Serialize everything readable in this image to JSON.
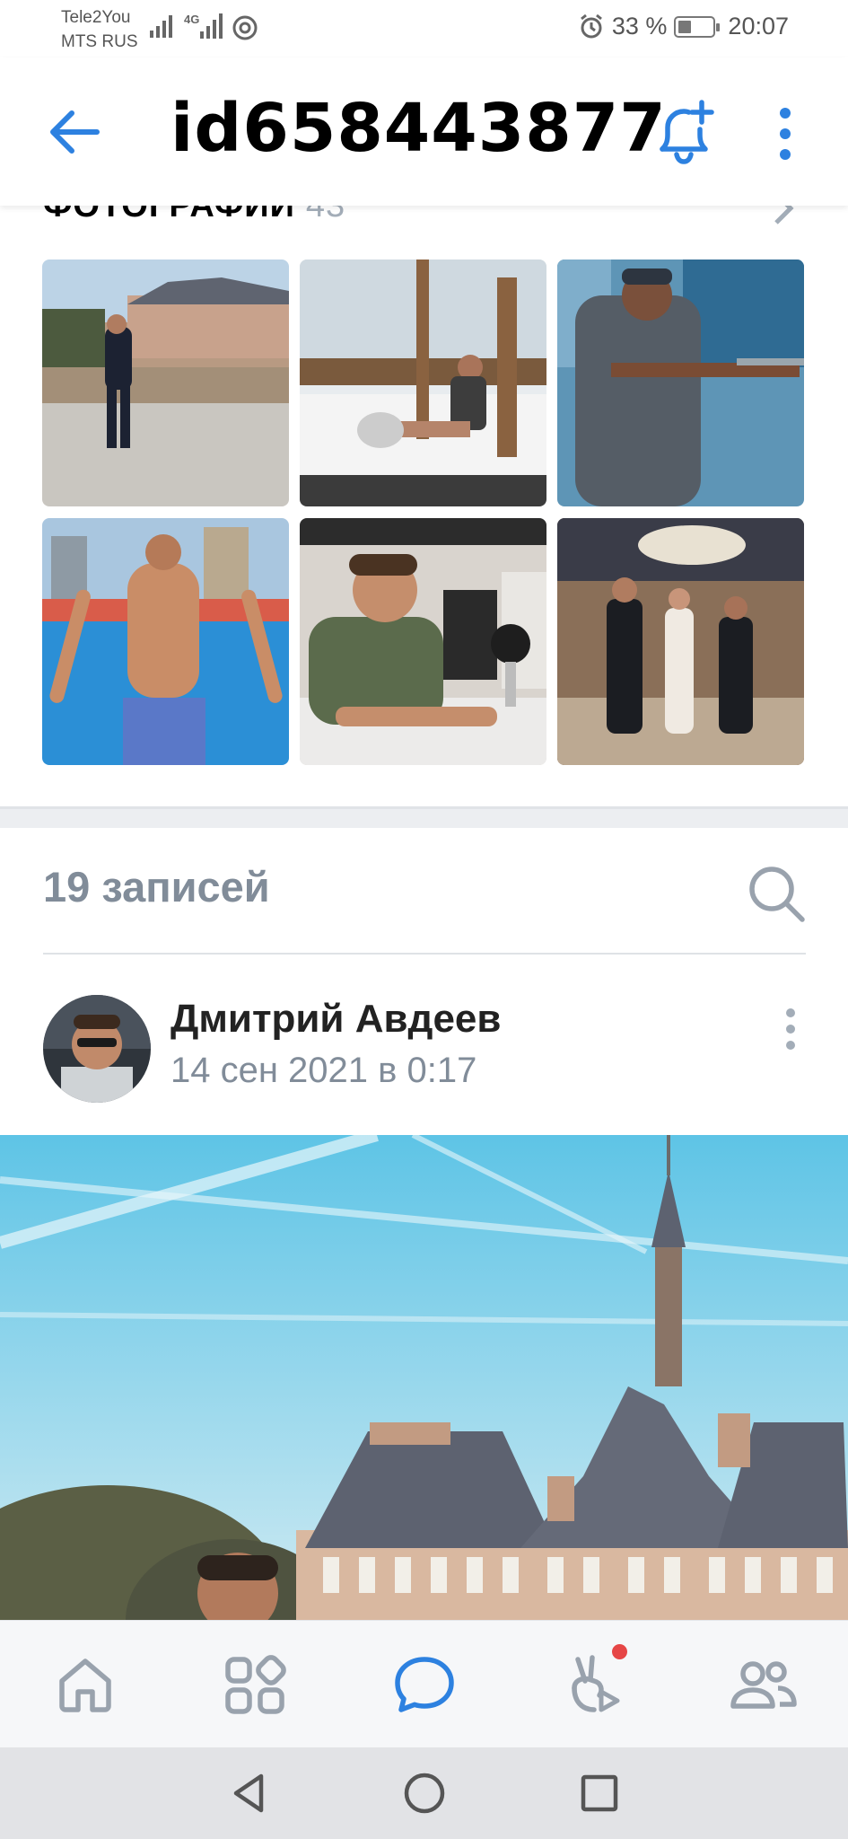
{
  "status_bar": {
    "carrier_1": "Tele2You",
    "carrier_2": "MTS RUS",
    "network": "4G",
    "battery": "33 %",
    "battery_level": 0.33,
    "time": "20:07"
  },
  "header": {
    "title": "id658443877"
  },
  "photos": {
    "title": "ФОТОГРАФИИ",
    "count": "43"
  },
  "posts": {
    "count_label": "19 записей"
  },
  "post": {
    "author": "Дмитрий Авдеев",
    "date": "14 сен 2021 в 0:17"
  },
  "tabs": [
    {
      "icon": "home-icon"
    },
    {
      "icon": "services-icon"
    },
    {
      "icon": "messages-icon",
      "active": true
    },
    {
      "icon": "clips-icon",
      "badge": true
    },
    {
      "icon": "friends-icon"
    }
  ],
  "colors": {
    "accent": "#2d81e0",
    "muted": "#818c99",
    "badge": "#e64646"
  }
}
